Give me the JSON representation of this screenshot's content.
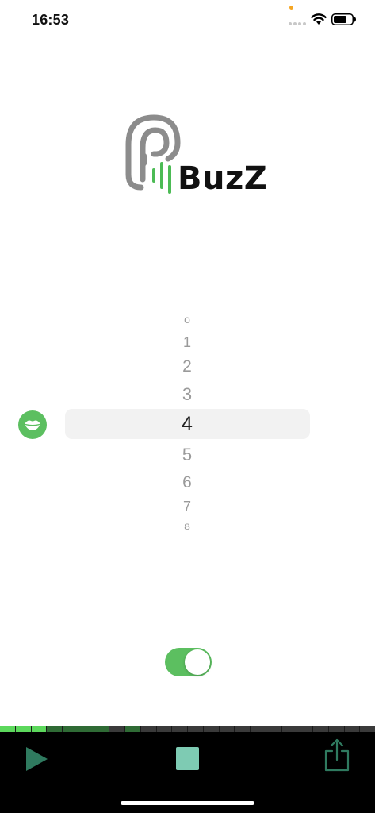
{
  "status_bar": {
    "time": "16:53",
    "icons": [
      "microphone-indicator-dot",
      "cellular-signal-icon",
      "wifi-icon",
      "battery-icon"
    ]
  },
  "logo": {
    "text": "BuzZ",
    "icon": "ear-sound-icon",
    "colors": {
      "ear": "#8c8c8c",
      "bars": "#4cbb55"
    }
  },
  "picker": {
    "options": [
      "0",
      "1",
      "2",
      "3",
      "4",
      "5",
      "6",
      "7",
      "8"
    ],
    "selected": "4",
    "side_button_icon": "lips-icon"
  },
  "toggle": {
    "state": "on",
    "color": "#5cbf60"
  },
  "level_meter": {
    "segments_total": 24,
    "active_segments": 9,
    "colors": {
      "bright": "#5cd85c",
      "dim": "#2f6b35",
      "off": "#3a3a3a"
    }
  },
  "toolbar": {
    "icons": [
      "play-icon",
      "stop-icon",
      "share-icon"
    ],
    "colors": {
      "play": "#2f7a5f",
      "stop": "#7ecbb3",
      "share": "#2f7a5f"
    }
  }
}
